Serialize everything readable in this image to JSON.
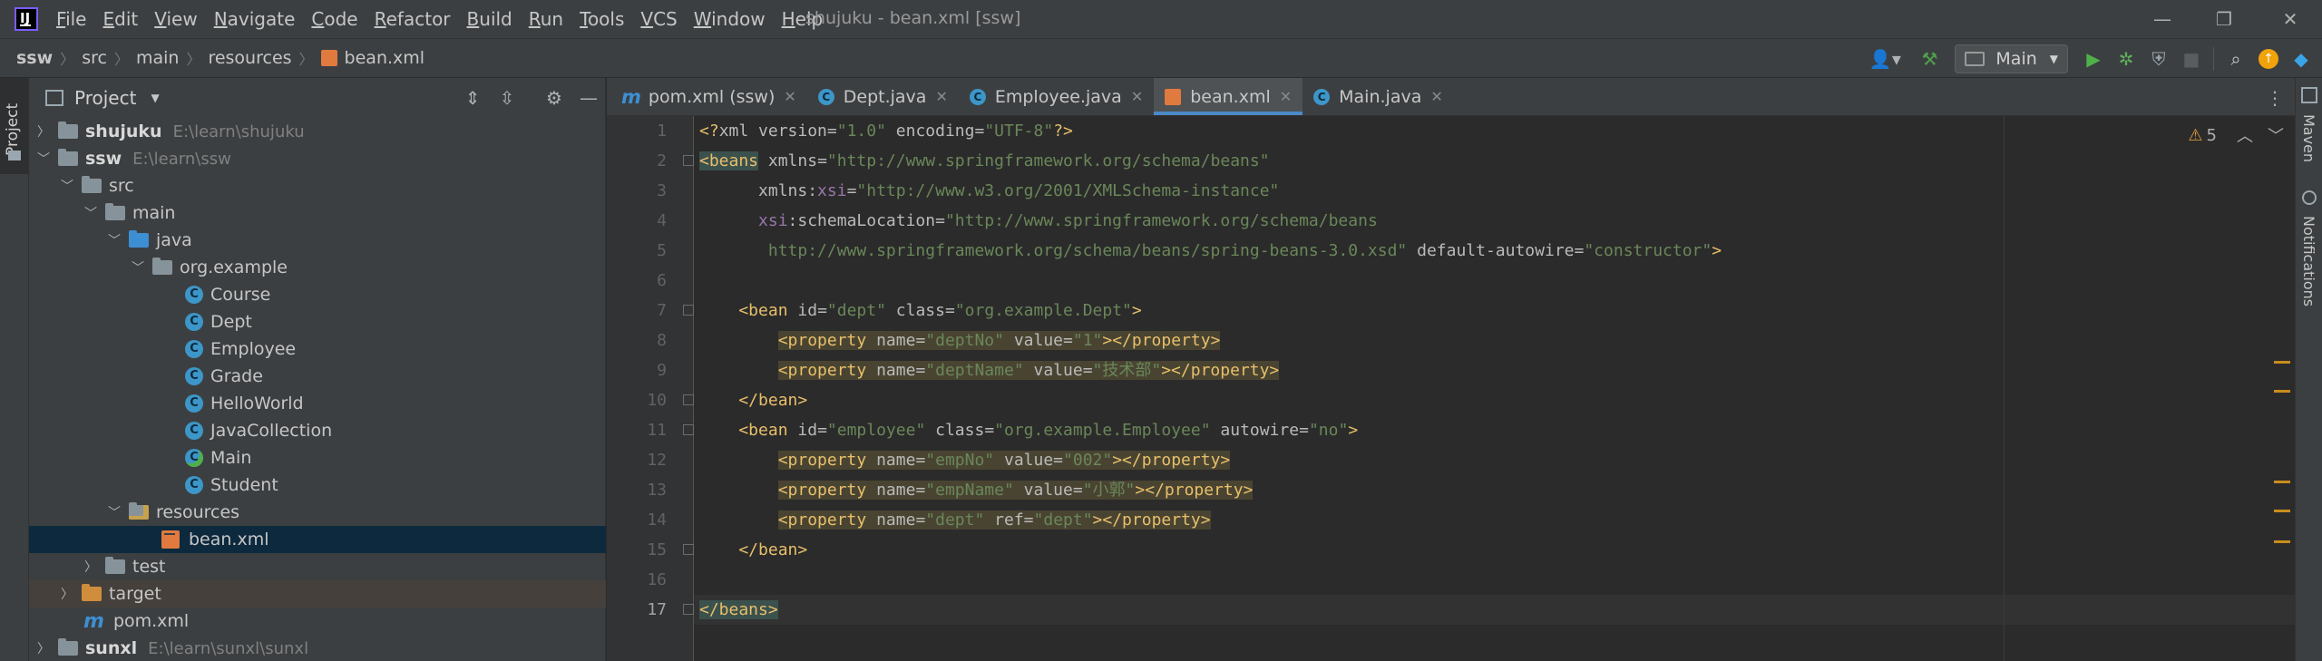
{
  "titlebar": {
    "menu": [
      {
        "first": "F",
        "rest": "ile"
      },
      {
        "first": "E",
        "rest": "dit"
      },
      {
        "first": "V",
        "rest": "iew"
      },
      {
        "first": "N",
        "rest": "avigate"
      },
      {
        "first": "C",
        "rest": "ode"
      },
      {
        "first": "R",
        "rest": "efactor"
      },
      {
        "first": "B",
        "rest": "uild"
      },
      {
        "first": "R",
        "rest": "un"
      },
      {
        "first": "T",
        "rest": "ools"
      },
      {
        "first": "V",
        "rest": "CS"
      },
      {
        "first": "W",
        "rest": "indow"
      },
      {
        "first": "H",
        "rest": "elp"
      }
    ],
    "window_title": "shujuku - bean.xml [ssw]",
    "logo_text": "IJ"
  },
  "breadcrumb": [
    "ssw",
    "src",
    "main",
    "resources",
    "bean.xml"
  ],
  "toolbar": {
    "run_config": "Main"
  },
  "project_panel": {
    "title": "Project",
    "tab_label": "Project",
    "tree": [
      {
        "label": "shujuku",
        "path": "E:\\learn\\shujuku"
      },
      {
        "label": "ssw",
        "path": "E:\\learn\\ssw"
      },
      {
        "label": "src"
      },
      {
        "label": "main"
      },
      {
        "label": "java"
      },
      {
        "label": "org.example"
      },
      {
        "label": "Course"
      },
      {
        "label": "Dept"
      },
      {
        "label": "Employee"
      },
      {
        "label": "Grade"
      },
      {
        "label": "HelloWorld"
      },
      {
        "label": "JavaCollection"
      },
      {
        "label": "Main"
      },
      {
        "label": "Student"
      },
      {
        "label": "resources"
      },
      {
        "label": "bean.xml"
      },
      {
        "label": "test"
      },
      {
        "label": "target"
      },
      {
        "label": "pom.xml"
      },
      {
        "label": "sunxl",
        "path": "E:\\learn\\sunxl\\sunxl"
      }
    ]
  },
  "tabs": [
    {
      "label": "pom.xml (ssw)"
    },
    {
      "label": "Dept.java"
    },
    {
      "label": "Employee.java"
    },
    {
      "label": "bean.xml"
    },
    {
      "label": "Main.java"
    }
  ],
  "editor": {
    "line_numbers": [
      "1",
      "2",
      "3",
      "4",
      "5",
      "6",
      "7",
      "8",
      "9",
      "10",
      "11",
      "12",
      "13",
      "14",
      "15",
      "16",
      "17"
    ],
    "warning_count": "5",
    "lines": {
      "l1": {
        "a": "<?",
        "b": "xml version",
        "c": "=",
        "d": "\"1.0\"",
        "e": " encoding",
        "f": "=",
        "g": "\"UTF-8\"",
        "h": "?>"
      },
      "l2": {
        "tag": "<beans",
        "attr": " xmlns",
        "eq": "=",
        "val": "\"http://www.springframework.org/schema/beans\""
      },
      "l3": {
        "attr": "      xmlns:",
        "ns": "xsi",
        "eq": "=",
        "val": "\"http://www.w3.org/2001/XMLSchema-instance\""
      },
      "l4": {
        "ns": "      xsi",
        "attr": ":schemaLocation",
        "eq": "=",
        "val": "\"http://www.springframework.org/schema/beans"
      },
      "l5": {
        "val": "       http://www.springframework.org/schema/beans/spring-beans-3.0.xsd\"",
        "attr": " default-autowire",
        "eq": "=",
        "val2": "\"constructor\"",
        "end": ">"
      },
      "l7": {
        "tag": "    <bean",
        "a1": " id",
        "eq1": "=",
        "v1": "\"dept\"",
        "a2": " class",
        "eq2": "=",
        "v2": "\"org.example.Dept\"",
        "end": ">"
      },
      "l8": {
        "tag": "<property",
        "a1": " name",
        "eq1": "=",
        "v1": "\"deptNo\"",
        "a2": " value",
        "eq2": "=",
        "v2": "\"1\"",
        "end": "></property>"
      },
      "l9": {
        "tag": "<property",
        "a1": " name",
        "eq1": "=",
        "v1": "\"deptName\"",
        "a2": " value",
        "eq2": "=",
        "v2": "\"技术部\"",
        "end": "></property>"
      },
      "l10": {
        "tag": "    </bean>"
      },
      "l11": {
        "tag": "    <bean",
        "a1": " id",
        "eq1": "=",
        "v1": "\"employee\"",
        "a2": " class",
        "eq2": "=",
        "v2": "\"org.example.Employee\"",
        "a3": " autowire",
        "eq3": "=",
        "v3": "\"no\"",
        "end": ">"
      },
      "l12": {
        "tag": "<property",
        "a1": " name",
        "eq1": "=",
        "v1": "\"empNo\"",
        "a2": " value",
        "eq2": "=",
        "v2": "\"002\"",
        "end": "></property>"
      },
      "l13": {
        "tag": "<property",
        "a1": " name",
        "eq1": "=",
        "v1": "\"empName\"",
        "a2": " value",
        "eq2": "=",
        "v2": "\"小郭\"",
        "end": "></property>"
      },
      "l14": {
        "tag": "<property",
        "a1": " name",
        "eq1": "=",
        "v1": "\"dept\"",
        "a2": " ref",
        "eq2": "=",
        "v2": "\"dept\"",
        "end": "></property>"
      },
      "l15": {
        "tag": "    </bean>"
      },
      "l17": {
        "tag": "</beans>"
      }
    }
  },
  "right_strip": {
    "maven": "Maven",
    "notifications": "Notifications"
  },
  "colors": {
    "accent": "#4a88c7",
    "selection": "#0d293e",
    "warning": "#e5a03c"
  }
}
